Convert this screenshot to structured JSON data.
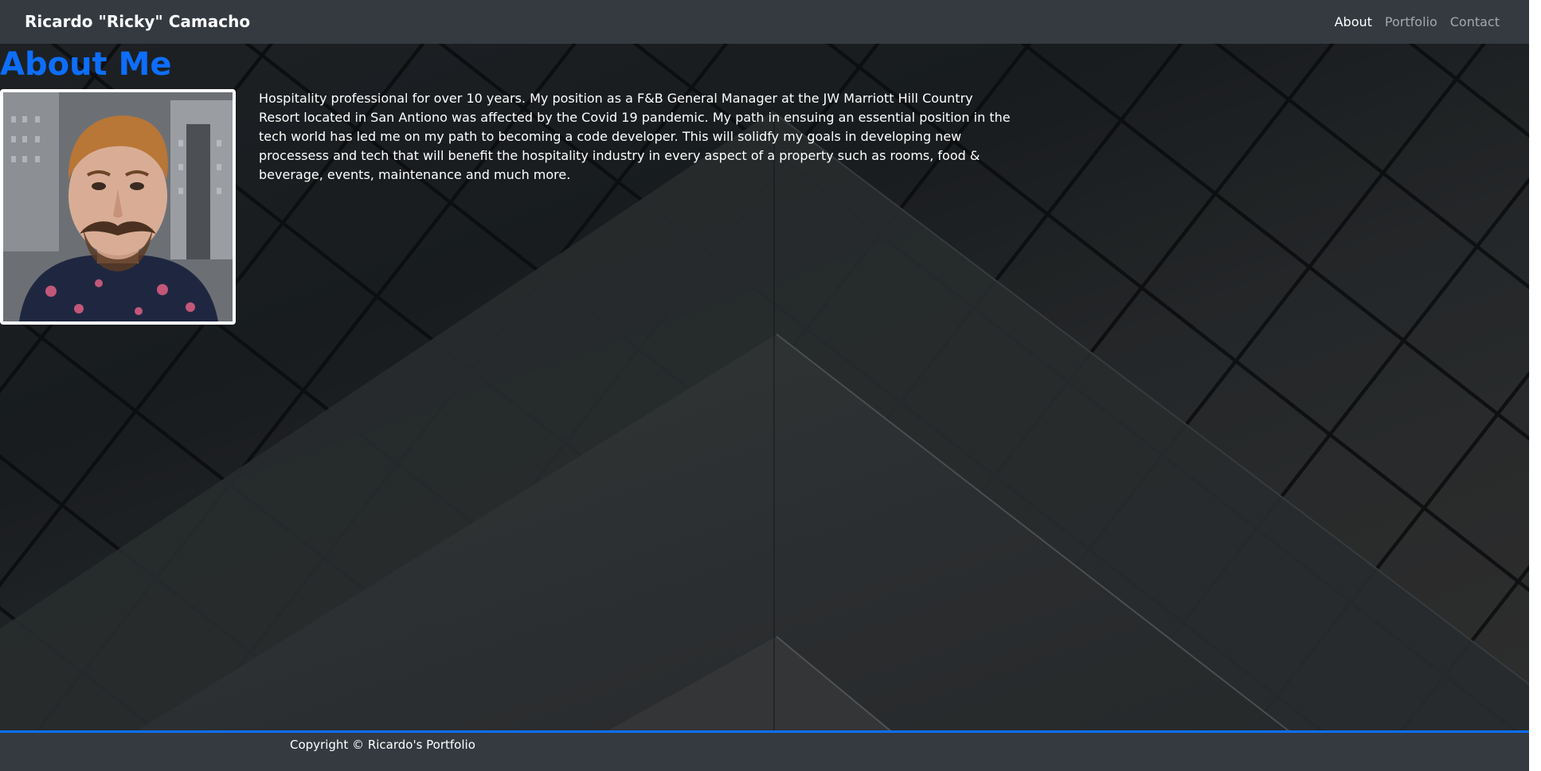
{
  "navbar": {
    "brand": "Ricardo \"Ricky\" Camacho",
    "links": [
      {
        "label": "About",
        "active": true
      },
      {
        "label": "Portfolio",
        "active": false
      },
      {
        "label": "Contact",
        "active": false
      }
    ]
  },
  "about": {
    "heading": "About Me",
    "bio": "Hospitality professional for over 10 years. My position as a F&B General Manager at the JW Marriott Hill Country Resort located in San Antiono was affected by the Covid 19 pandemic. My path in ensuing an essential position in the tech world has led me on my path to becoming a code developer. This will solidfy my goals in developing new processess and tech that will benefit the hospitality industry in every aspect of a property such as rooms, food & beverage, events, maintenance and much more."
  },
  "footer": {
    "copyright": "Copyright © Ricardo's Portfolio"
  },
  "colors": {
    "accent": "#0d6efd",
    "navbar_bg": "#343a40",
    "muted_link": "rgba(255,255,255,0.55)"
  }
}
